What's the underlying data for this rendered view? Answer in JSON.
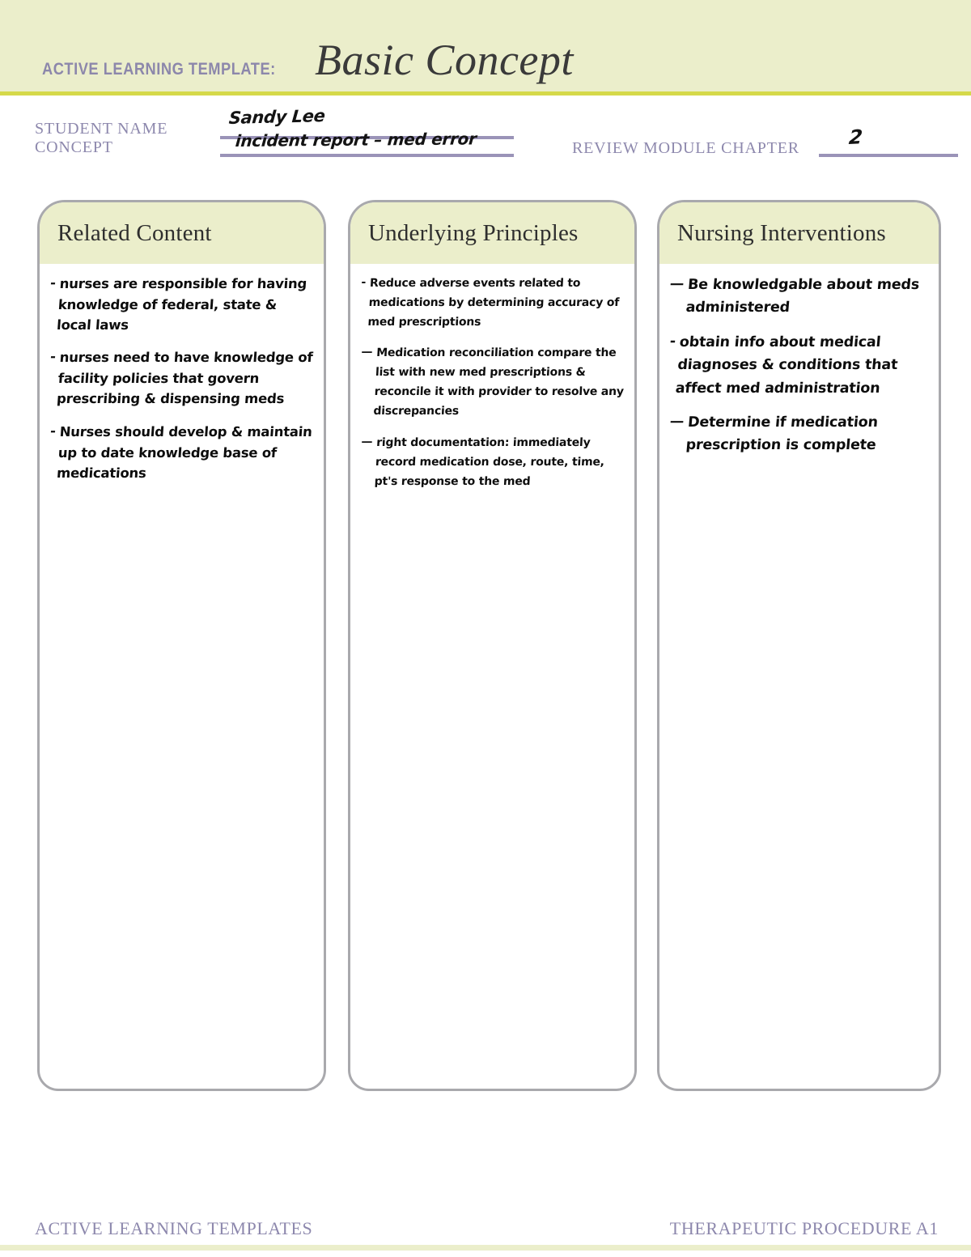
{
  "banner": {
    "kicker": "ACTIVE LEARNING TEMPLATE:",
    "title": "Basic Concept"
  },
  "form": {
    "student_name_label": "STUDENT NAME",
    "student_name_value": "Sandy Lee",
    "concept_label": "CONCEPT",
    "concept_value": "incident report – med error",
    "chapter_label": "REVIEW MODULE CHAPTER",
    "chapter_value": "2"
  },
  "columns": [
    {
      "title": "Related Content",
      "notes": [
        {
          "dash": "-",
          "text": "nurses are responsible for having knowledge of federal, state & local laws",
          "gap": false
        },
        {
          "dash": "-",
          "text": "nurses need to have knowledge of facility policies that govern prescribing & dispensing meds",
          "gap": false
        },
        {
          "dash": "-",
          "text": "Nurses should develop & maintain up to date knowledge base of medications",
          "gap": true
        }
      ]
    },
    {
      "title": "Underlying Principles",
      "notes": [
        {
          "dash": "-",
          "text": "Reduce adverse events related to medications by determining accuracy of med prescriptions",
          "gap": false
        },
        {
          "dash": "—",
          "text": "Medication reconciliation compare the list with new med prescriptions & reconcile it with provider to resolve any discrepancies",
          "gap": false
        },
        {
          "dash": "—",
          "text": "right documentation: immediately record medication dose, route, time, pt's response to the med",
          "gap": false
        }
      ]
    },
    {
      "title": "Nursing Interventions",
      "notes": [
        {
          "dash": "—",
          "text": "Be knowledgable about meds administered",
          "gap": false
        },
        {
          "dash": "-",
          "text": "obtain info about medical diagnoses & conditions that affect med administration",
          "gap": false
        },
        {
          "dash": "—",
          "text": "Determine if medication prescription is complete",
          "gap": false
        }
      ]
    }
  ],
  "footer": {
    "left": "ACTIVE LEARNING TEMPLATES",
    "right": "THERAPEUTIC PROCEDURE  A1"
  },
  "colors": {
    "banner_bg": "#ebeecb",
    "banner_rule": "#d5d94a",
    "label_purple": "#8d88ad",
    "field_line": "#9a93b8",
    "box_border": "#a9a9ad",
    "ink": "#0d0d0d"
  }
}
